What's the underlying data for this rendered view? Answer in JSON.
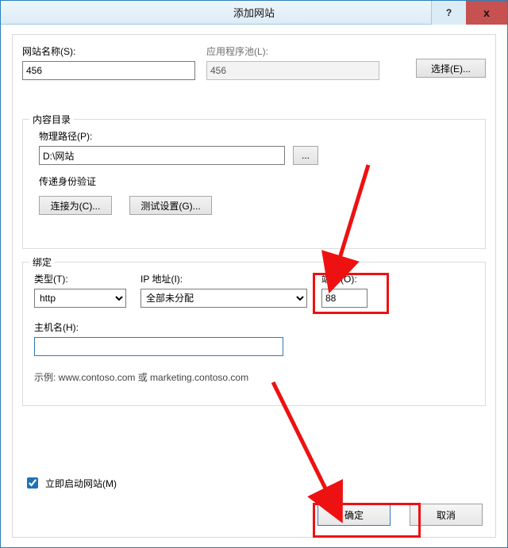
{
  "title": "添加网站",
  "titlebar": {
    "help": "?",
    "close": "x"
  },
  "labels": {
    "siteName": "网站名称(S):",
    "appPool": "应用程序池(L):",
    "select": "选择(E)...",
    "contentDir": "内容目录",
    "physicalPath": "物理路径(P):",
    "browse": "...",
    "passThrough": "传递身份验证",
    "connectAs": "连接为(C)...",
    "testSettings": "测试设置(G)...",
    "binding": "绑定",
    "type": "类型(T):",
    "ip": "IP 地址(I):",
    "port": "端口(O):",
    "host": "主机名(H):",
    "example": "示例: www.contoso.com 或 marketing.contoso.com",
    "autoStart": "立即启动网站(M)",
    "ok": "确定",
    "cancel": "取消"
  },
  "values": {
    "siteName": "456",
    "appPool": "456",
    "physicalPath": "D:\\网站",
    "type": "http",
    "ip": "全部未分配",
    "port": "88",
    "host": "",
    "autoStart": true
  }
}
